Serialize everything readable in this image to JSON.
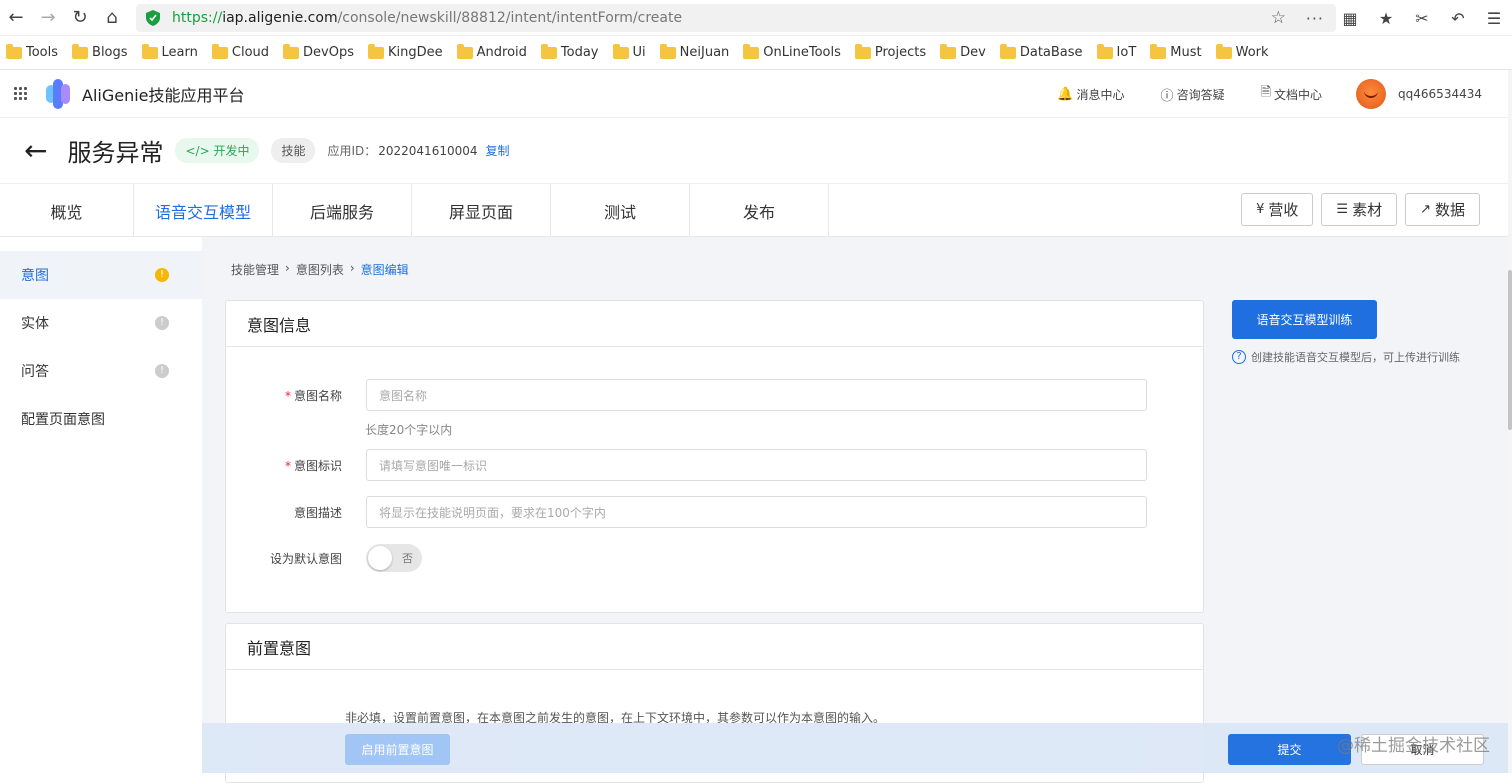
{
  "browser": {
    "url_scheme": "https://",
    "url_host": "iap.aligenie.com",
    "url_path": "/console/newskill/88812/intent/intentForm/create",
    "bookmarks": [
      "Tools",
      "Blogs",
      "Learn",
      "Cloud",
      "DevOps",
      "KingDee",
      "Android",
      "Today",
      "Ui",
      "NeiJuan",
      "OnLineTools",
      "Projects",
      "Dev",
      "DataBase",
      "IoT",
      "Must",
      "Work"
    ]
  },
  "header": {
    "app_title": "AliGenie技能应用平台",
    "links": {
      "messages": "消息中心",
      "consult": "咨询答疑",
      "docs": "文档中心"
    },
    "username": "qq466534434"
  },
  "page": {
    "title": "服务异常",
    "status_tag": "开发中",
    "type_tag": "技能",
    "app_id_label": "应用ID：",
    "app_id": "2022041610004",
    "copy_label": "复制"
  },
  "tabs": [
    "概览",
    "语音交互模型",
    "后端服务",
    "屏显页面",
    "测试",
    "发布"
  ],
  "tab_actions": {
    "revenue": "营收",
    "assets": "素材",
    "data": "数据"
  },
  "sidebar": {
    "items": [
      {
        "label": "意图"
      },
      {
        "label": "实体"
      },
      {
        "label": "问答"
      },
      {
        "label": "配置页面意图"
      }
    ]
  },
  "breadcrumb": [
    "技能管理",
    "意图列表",
    "意图编辑"
  ],
  "intent_card": {
    "title": "意图信息",
    "name": {
      "label": "意图名称",
      "placeholder": "意图名称",
      "hint": "长度20个字以内"
    },
    "identifier": {
      "label": "意图标识",
      "placeholder": "请填写意图唯一标识"
    },
    "description": {
      "label": "意图描述",
      "placeholder": "将显示在技能说明页面，要求在100个字内"
    },
    "default": {
      "label": "设为默认意图",
      "switch_text": "否",
      "on": false
    }
  },
  "pre_card": {
    "title": "前置意图",
    "desc": "非必填，设置前置意图，在本意图之前发生的意图，在上下文环境中，其参数可以作为本意图的输入。"
  },
  "train": {
    "button": "语音交互模型训练",
    "hint": "创建技能语音交互模型后，可上传进行训练"
  },
  "footer": {
    "enable_pre": "启用前置意图",
    "submit": "提交",
    "cancel": "取消"
  },
  "watermark": "@稀土掘金技术社区",
  "colors": {
    "accent": "#1f6fe0",
    "warning": "#f5b800",
    "secure": "#1a9e3f"
  }
}
